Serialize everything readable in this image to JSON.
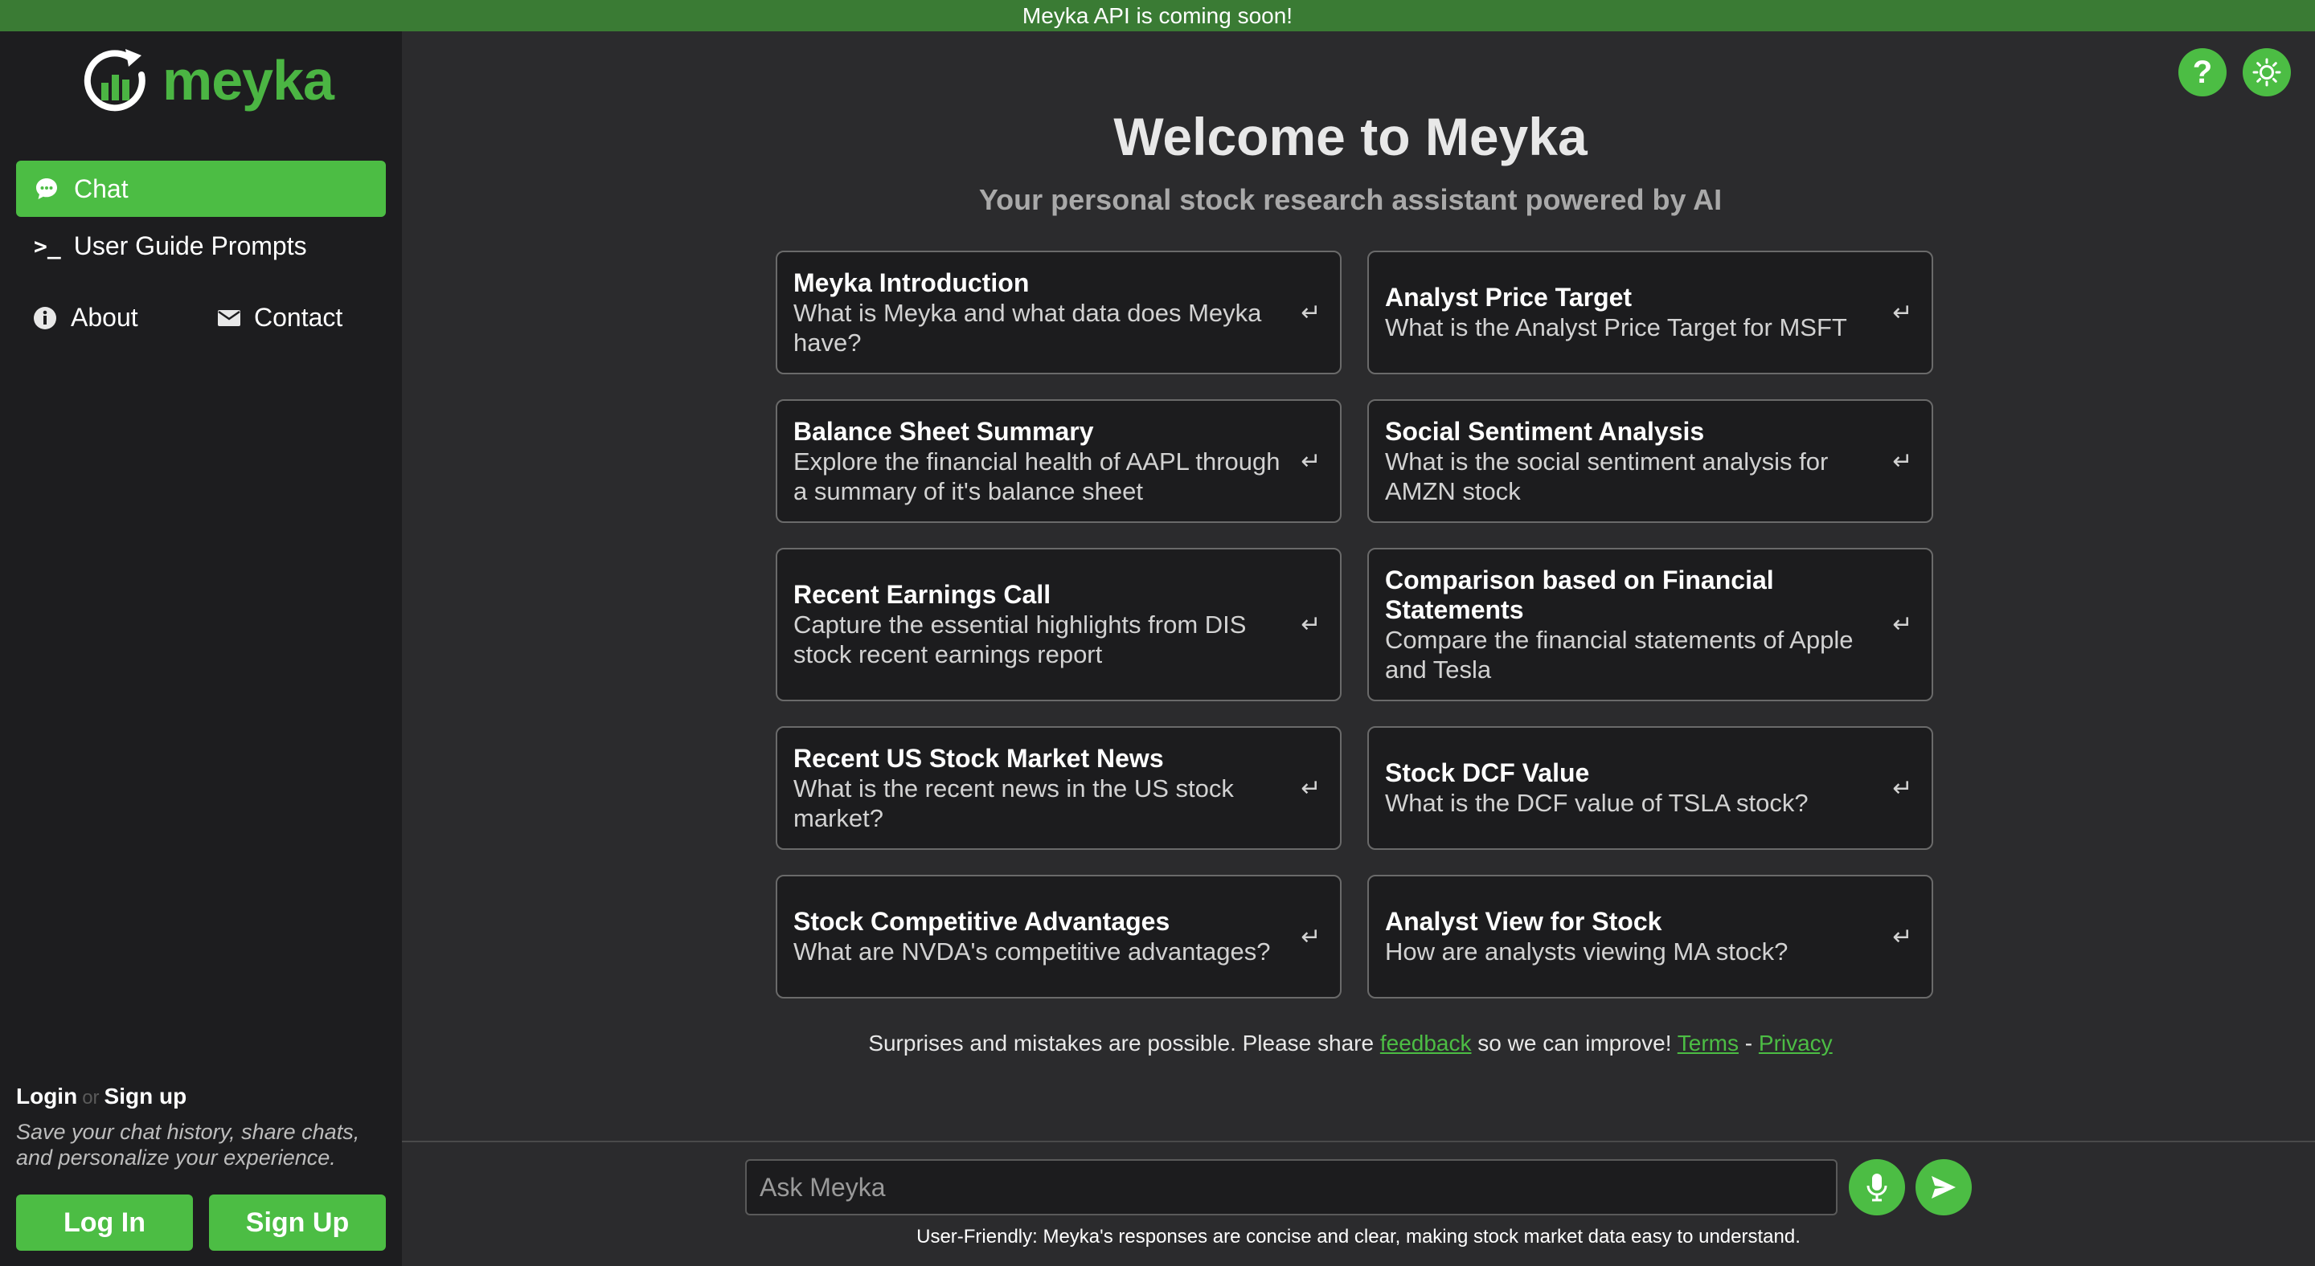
{
  "banner": {
    "text": "Meyka API is coming soon!"
  },
  "brand": {
    "name": "meyka",
    "accent": "#4cbd44",
    "banner_color": "#3a7b34"
  },
  "sidebar": {
    "chat_label": "Chat",
    "chat_icon": "chat-bubble-icon",
    "guide_label": "User Guide Prompts",
    "guide_icon": "terminal-prompt-icon",
    "about_label": "About",
    "about_icon": "info-icon",
    "contact_label": "Contact",
    "contact_icon": "mail-icon",
    "login_word": "Login",
    "or_word": "or",
    "signup_word": "Sign up",
    "login_note": "Save your chat history, share chats, and personalize your experience.",
    "login_button": "Log In",
    "signup_button": "Sign Up"
  },
  "header_icons": {
    "help": "question-mark-icon",
    "theme": "sun-icon"
  },
  "main": {
    "title": "Welcome to Meyka",
    "subtitle": "Your personal stock research assistant powered by AI",
    "cards": [
      {
        "title": "Meyka Introduction",
        "desc": "What is Meyka and what data does Meyka have?"
      },
      {
        "title": "Analyst Price Target",
        "desc": "What is the Analyst Price Target for MSFT"
      },
      {
        "title": "Balance Sheet Summary",
        "desc": "Explore the financial health of AAPL through a summary of it's balance sheet"
      },
      {
        "title": "Social Sentiment Analysis",
        "desc": "What is the social sentiment analysis for AMZN stock"
      },
      {
        "title": "Recent Earnings Call",
        "desc": "Capture the essential highlights from DIS stock recent earnings report"
      },
      {
        "title": "Comparison based on Financial Statements",
        "desc": "Compare the financial statements of Apple and Tesla"
      },
      {
        "title": "Recent US Stock Market News",
        "desc": "What is the recent news in the US stock market?"
      },
      {
        "title": "Stock DCF Value",
        "desc": "What is the DCF value of TSLA stock?"
      },
      {
        "title": "Stock Competitive Advantages",
        "desc": "What are NVDA's competitive advantages?"
      },
      {
        "title": "Analyst View for Stock",
        "desc": "How are analysts viewing MA stock?"
      }
    ],
    "enter_glyph": "↵",
    "footer": {
      "before": "Surprises and mistakes are possible. Please share ",
      "feedback": "feedback",
      "middle": " so we can improve! ",
      "terms": "Terms",
      "sep": " - ",
      "privacy": "Privacy"
    }
  },
  "composer": {
    "placeholder": "Ask Meyka",
    "mic_icon": "microphone-icon",
    "send_icon": "send-icon",
    "note": "User-Friendly: Meyka's responses are concise and clear, making stock market data easy to understand."
  }
}
